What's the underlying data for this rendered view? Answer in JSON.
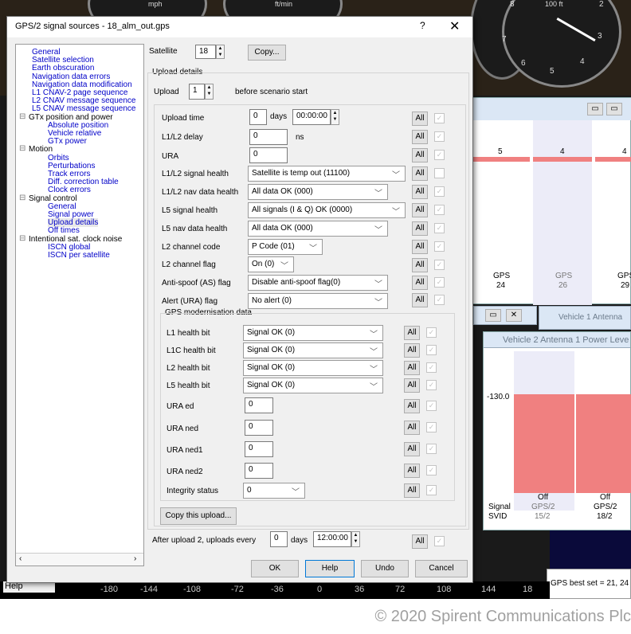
{
  "background": {
    "speed_unit": "mph",
    "vs_unit": "ft/min",
    "alt_label": "100 ft",
    "altimeter_digits": [
      "8",
      "2",
      "7",
      "3",
      "6",
      "4",
      "5"
    ],
    "gauge_zero": "0",
    "bar_values": [
      "5",
      "4",
      "4"
    ],
    "sv_labels": [
      {
        "c": "GPS",
        "n": "24"
      },
      {
        "c": "GPS",
        "n": "26"
      },
      {
        "c": "GPS",
        "n": "29"
      }
    ],
    "antenna1_title": "Vehicle 1 Antenna",
    "antenna2_title": "Vehicle 2 Antenna 1 Power Leve",
    "power_level": "-130.0",
    "signal_label": "Signal",
    "svid_label": "SVID",
    "sig_cols": [
      {
        "state": "Off",
        "c": "GPS/2",
        "n": "15/2"
      },
      {
        "state": "Off",
        "c": "GPS/2",
        "n": "18/2"
      }
    ],
    "best_set": "GPS best set = 21, 24",
    "help_label": "Help",
    "axis_ticks": [
      "-180",
      "-144",
      "-108",
      "-72",
      "-36",
      "0",
      "36",
      "72",
      "108",
      "144",
      "18"
    ],
    "copyright": "© 2020 Spirent Communications Plc"
  },
  "dialog": {
    "title": "GPS/2 signal sources - 18_alm_out.gps",
    "help_glyph": "?",
    "close_glyph": "✕",
    "tree": [
      {
        "label": "General",
        "hdr": false
      },
      {
        "label": "Satellite selection",
        "hdr": false
      },
      {
        "label": "Earth obscuration",
        "hdr": false
      },
      {
        "label": "Navigation data errors",
        "hdr": false
      },
      {
        "label": "Navigation data modification",
        "hdr": false
      },
      {
        "label": "L1 CNAV-2 page sequence",
        "hdr": false
      },
      {
        "label": "L2 CNAV message sequence",
        "hdr": false
      },
      {
        "label": "L5 CNAV message sequence",
        "hdr": false
      },
      {
        "label": "GTx position and power",
        "hdr": true
      },
      {
        "label": "Absolute position",
        "hdr": false
      },
      {
        "label": "Vehicle relative",
        "hdr": false
      },
      {
        "label": "GTx power",
        "hdr": false
      },
      {
        "label": "Motion",
        "hdr": true
      },
      {
        "label": "Orbits",
        "hdr": false
      },
      {
        "label": "Perturbations",
        "hdr": false
      },
      {
        "label": "Track errors",
        "hdr": false
      },
      {
        "label": "Diff. correction table",
        "hdr": false
      },
      {
        "label": "Clock errors",
        "hdr": false
      },
      {
        "label": "Signal control",
        "hdr": true
      },
      {
        "label": "General",
        "hdr": false
      },
      {
        "label": "Signal power",
        "hdr": false
      },
      {
        "label": "Upload details",
        "hdr": false
      },
      {
        "label": "Off times",
        "hdr": false
      },
      {
        "label": "Intentional sat. clock noise",
        "hdr": true
      },
      {
        "label": "ISCN global",
        "hdr": false
      },
      {
        "label": "ISCN per satellite",
        "hdr": false
      }
    ],
    "satellite_label": "Satellite",
    "satellite_value": "18",
    "copy_label": "Copy...",
    "upload_details_legend": "Upload details",
    "upload_label": "Upload",
    "upload_value": "1",
    "before_start": "before scenario start",
    "upload_time_label": "Upload time",
    "upload_time_days": "0",
    "days_label": "days",
    "upload_time_clock": "00:00:00",
    "l1l2_delay_label": "L1/L2 delay",
    "l1l2_delay_value": "0",
    "ns_label": "ns",
    "ura_label": "URA",
    "ura_value": "0",
    "l1l2_health_label": "L1/L2 signal health",
    "l1l2_health_value": "Satellite is temp out (11100)",
    "l1l2_nav_label": "L1/L2 nav data health",
    "l1l2_nav_value": "All data OK (000)",
    "l5_health_label": "L5 signal health",
    "l5_health_value": "All signals (I & Q) OK (0000)",
    "l5_nav_label": "L5 nav data health",
    "l5_nav_value": "All data OK (000)",
    "l2_code_label": "L2 channel code",
    "l2_code_value": "P Code (01)",
    "l2_flag_label": "L2 channel flag",
    "l2_flag_value": "On (0)",
    "as_label": "Anti-spoof (AS) flag",
    "as_value": "Disable anti-spoof flag(0)",
    "alert_label": "Alert (URA) flag",
    "alert_value": "No alert (0)",
    "modern_legend": "GPS modernisation data",
    "l1_hb_label": "L1 health bit",
    "l1_hb_value": "Signal OK (0)",
    "l1c_hb_label": "L1C health bit",
    "l1c_hb_value": "Signal OK (0)",
    "l2_hb_label": "L2 health bit",
    "l2_hb_value": "Signal OK (0)",
    "l5_hb_label": "L5 health bit",
    "l5_hb_value": "Signal OK (0)",
    "ura_ed_label": "URA ed",
    "ura_ed_value": "0",
    "ura_ned_label": "URA ned",
    "ura_ned_value": "0",
    "ura_ned1_label": "URA ned1",
    "ura_ned1_value": "0",
    "ura_ned2_label": "URA ned2",
    "ura_ned2_value": "0",
    "integrity_label": "Integrity status",
    "integrity_value": "0",
    "copy_upload_label": "Copy this upload...",
    "after_upload_label": "After upload 2, uploads every",
    "after_days_value": "0",
    "after_days_label": "days",
    "after_clock": "12:00:00",
    "all_label": "All",
    "ok_label": "OK",
    "help_label": "Help",
    "undo_label": "Undo",
    "cancel_label": "Cancel"
  }
}
